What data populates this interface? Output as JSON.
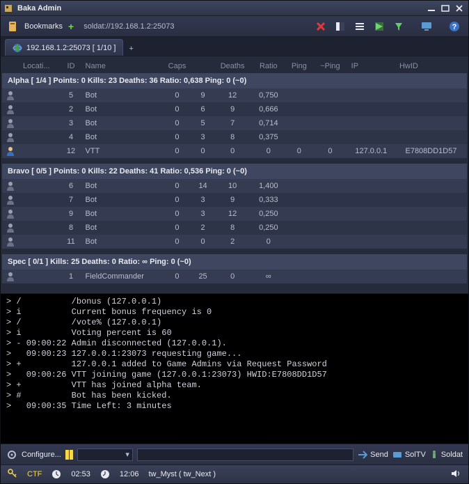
{
  "window": {
    "title": "Baka Admin"
  },
  "toolbar": {
    "bookmarks_label": "Bookmarks",
    "address": "soldat://192.168.1.2:25073"
  },
  "tab": {
    "label": "192.168.1.2:25073 [ 1/10 ]"
  },
  "columns": {
    "location": "Locati...",
    "id": "ID",
    "name": "Name",
    "caps": "Caps",
    "kills": "",
    "deaths": "Deaths",
    "ratio": "Ratio",
    "ping": "Ping",
    "epingh": "~Ping",
    "ip": "IP",
    "hwid": "HwID"
  },
  "teams": [
    {
      "header": "Alpha [ 1/4 ] Points: 0 Kills: 23 Deaths: 36 Ratio: 0,638 Ping: 0 (~0)",
      "rows": [
        {
          "id": "5",
          "name": "Bot",
          "caps": "0",
          "kills": "9",
          "deaths": "12",
          "ratio": "0,750",
          "ping": "",
          "eping": "",
          "ip": "",
          "hwid": "",
          "human": false
        },
        {
          "id": "2",
          "name": "Bot",
          "caps": "0",
          "kills": "6",
          "deaths": "9",
          "ratio": "0,666",
          "ping": "",
          "eping": "",
          "ip": "",
          "hwid": "",
          "human": false
        },
        {
          "id": "3",
          "name": "Bot",
          "caps": "0",
          "kills": "5",
          "deaths": "7",
          "ratio": "0,714",
          "ping": "",
          "eping": "",
          "ip": "",
          "hwid": "",
          "human": false
        },
        {
          "id": "4",
          "name": "Bot",
          "caps": "0",
          "kills": "3",
          "deaths": "8",
          "ratio": "0,375",
          "ping": "",
          "eping": "",
          "ip": "",
          "hwid": "",
          "human": false
        },
        {
          "id": "12",
          "name": "VTT",
          "caps": "0",
          "kills": "0",
          "deaths": "0",
          "ratio": "0",
          "ping": "0",
          "eping": "0",
          "ip": "127.0.0.1",
          "hwid": "E7808DD1D57",
          "human": true
        }
      ]
    },
    {
      "header": "Bravo [ 0/5 ] Points: 0 Kills: 22 Deaths: 41 Ratio: 0,536 Ping: 0 (~0)",
      "rows": [
        {
          "id": "6",
          "name": "Bot",
          "caps": "0",
          "kills": "14",
          "deaths": "10",
          "ratio": "1,400",
          "ping": "",
          "eping": "",
          "ip": "",
          "hwid": "",
          "human": false
        },
        {
          "id": "7",
          "name": "Bot",
          "caps": "0",
          "kills": "3",
          "deaths": "9",
          "ratio": "0,333",
          "ping": "",
          "eping": "",
          "ip": "",
          "hwid": "",
          "human": false
        },
        {
          "id": "9",
          "name": "Bot",
          "caps": "0",
          "kills": "3",
          "deaths": "12",
          "ratio": "0,250",
          "ping": "",
          "eping": "",
          "ip": "",
          "hwid": "",
          "human": false
        },
        {
          "id": "8",
          "name": "Bot",
          "caps": "0",
          "kills": "2",
          "deaths": "8",
          "ratio": "0,250",
          "ping": "",
          "eping": "",
          "ip": "",
          "hwid": "",
          "human": false
        },
        {
          "id": "11",
          "name": "Bot",
          "caps": "0",
          "kills": "0",
          "deaths": "2",
          "ratio": "0",
          "ping": "",
          "eping": "",
          "ip": "",
          "hwid": "",
          "human": false
        }
      ]
    },
    {
      "header": "Spec [ 0/1 ] Kills: 25 Deaths: 0 Ratio: ∞ Ping: 0 (~0)",
      "rows": [
        {
          "id": "1",
          "name": "FieldCommander",
          "caps": "0",
          "kills": "25",
          "deaths": "0",
          "ratio": "∞",
          "ping": "",
          "eping": "",
          "ip": "",
          "hwid": "",
          "human": false
        }
      ]
    }
  ],
  "console": [
    {
      "p": "/",
      "t": "         /bonus (127.0.0.1)"
    },
    {
      "p": "i",
      "t": "         Current bonus frequency is 0"
    },
    {
      "p": "/",
      "t": "         /vote% (127.0.0.1)"
    },
    {
      "p": "i",
      "t": "         Voting percent is 60"
    },
    {
      "p": "-",
      "t": "09:00:22 Admin disconnected (127.0.0.1)."
    },
    {
      "p": " ",
      "t": "09:00:23 127.0.0.1:23073 requesting game..."
    },
    {
      "p": "+",
      "t": "         127.0.0.1 added to Game Admins via Request Password"
    },
    {
      "p": " ",
      "t": "09:00:26 VTT joining game (127.0.0.1:23073) HWID:E7808DD1D57"
    },
    {
      "p": "+",
      "t": "         VTT has joined alpha team."
    },
    {
      "p": "#",
      "t": "         Bot has been kicked."
    },
    {
      "p": " ",
      "t": "09:00:35 Time Left: 3 minutes"
    }
  ],
  "cmdbar": {
    "configure": "Configure...",
    "send": "Send",
    "soltv": "SolTV",
    "soldat": "Soldat"
  },
  "status": {
    "mode": "CTF",
    "time_left": "02:53",
    "clock": "12:06",
    "map": "tw_Myst ( tw_Next )"
  }
}
